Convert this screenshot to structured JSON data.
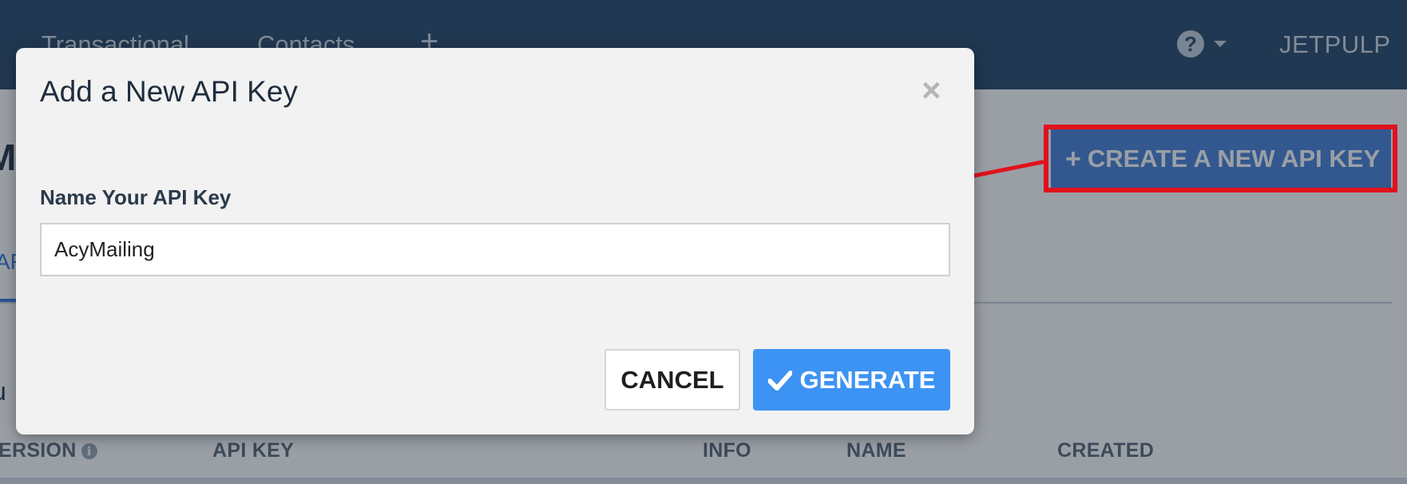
{
  "nav": {
    "items": [
      "Transactional",
      "Contacts"
    ],
    "add_icon": "+",
    "help_icon": "?",
    "user_label": "JETPULP"
  },
  "page": {
    "heading_fragment": "M",
    "tab_fragment": "AF",
    "text_fragment": "u",
    "create_button_label": "CREATE A NEW API KEY",
    "create_button_icon": "+"
  },
  "table": {
    "headers": [
      "ERSION",
      "API KEY",
      "INFO",
      "NAME",
      "CREATED"
    ]
  },
  "modal": {
    "title": "Add a New API Key",
    "close_icon": "×",
    "field_label": "Name Your API Key",
    "field_value": "AcyMailing",
    "cancel_label": "CANCEL",
    "generate_label": "GENERATE"
  },
  "colors": {
    "topbar": "#2f4e6e",
    "primary_button": "#3d93f3",
    "highlight": "#e0121c"
  }
}
